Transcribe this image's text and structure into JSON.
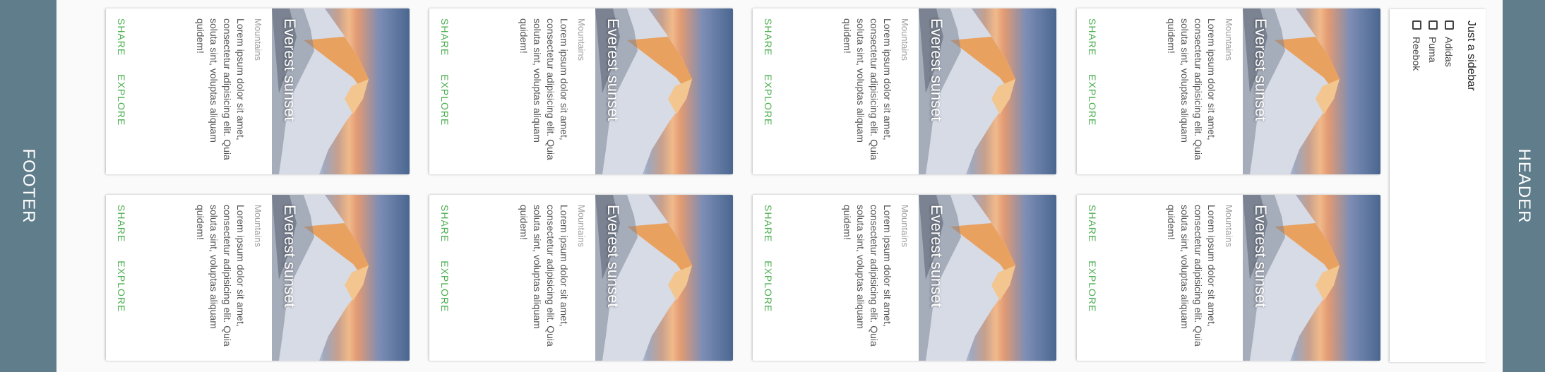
{
  "header": {
    "label": "HEADER"
  },
  "footer": {
    "label": "FOOTER"
  },
  "sidebar": {
    "title": "Just a sidebar",
    "brands": [
      {
        "label": "Adidas",
        "checked": false
      },
      {
        "label": "Puma",
        "checked": false
      },
      {
        "label": "Reebok",
        "checked": false
      }
    ]
  },
  "cards": [
    {
      "title": "Everest sunset",
      "category": "Mountains",
      "text": "Lorem ipsum dolor sit amet, consectetur adipisicing elit. Quia soluta sint, voluptas aliquam quidem!",
      "share": "SHARE",
      "explore": "EXPLORE"
    },
    {
      "title": "Everest sunset",
      "category": "Mountains",
      "text": "Lorem ipsum dolor sit amet, consectetur adipisicing elit. Quia soluta sint, voluptas aliquam quidem!",
      "share": "SHARE",
      "explore": "EXPLORE"
    },
    {
      "title": "Everest sunset",
      "category": "Mountains",
      "text": "Lorem ipsum dolor sit amet, consectetur adipisicing elit. Quia soluta sint, voluptas aliquam quidem!",
      "share": "SHARE",
      "explore": "EXPLORE"
    },
    {
      "title": "Everest sunset",
      "category": "Mountains",
      "text": "Lorem ipsum dolor sit amet, consectetur adipisicing elit. Quia soluta sint, voluptas aliquam quidem!",
      "share": "SHARE",
      "explore": "EXPLORE"
    },
    {
      "title": "Everest sunset",
      "category": "Mountains",
      "text": "Lorem ipsum dolor sit amet, consectetur adipisicing elit. Quia soluta sint, voluptas aliquam quidem!",
      "share": "SHARE",
      "explore": "EXPLORE"
    },
    {
      "title": "Everest sunset",
      "category": "Mountains",
      "text": "Lorem ipsum dolor sit amet, consectetur adipisicing elit. Quia soluta sint, voluptas aliquam quidem!",
      "share": "SHARE",
      "explore": "EXPLORE"
    },
    {
      "title": "Everest sunset",
      "category": "Mountains",
      "text": "Lorem ipsum dolor sit amet, consectetur adipisicing elit. Quia soluta sint, voluptas aliquam quidem!",
      "share": "SHARE",
      "explore": "EXPLORE"
    },
    {
      "title": "Everest sunset",
      "category": "Mountains",
      "text": "Lorem ipsum dolor sit amet, consectetur adipisicing elit. Quia soluta sint, voluptas aliquam quidem!",
      "share": "SHARE",
      "explore": "EXPLORE"
    }
  ],
  "colors": {
    "bar": "#607d8b",
    "action": "#4caf50"
  }
}
